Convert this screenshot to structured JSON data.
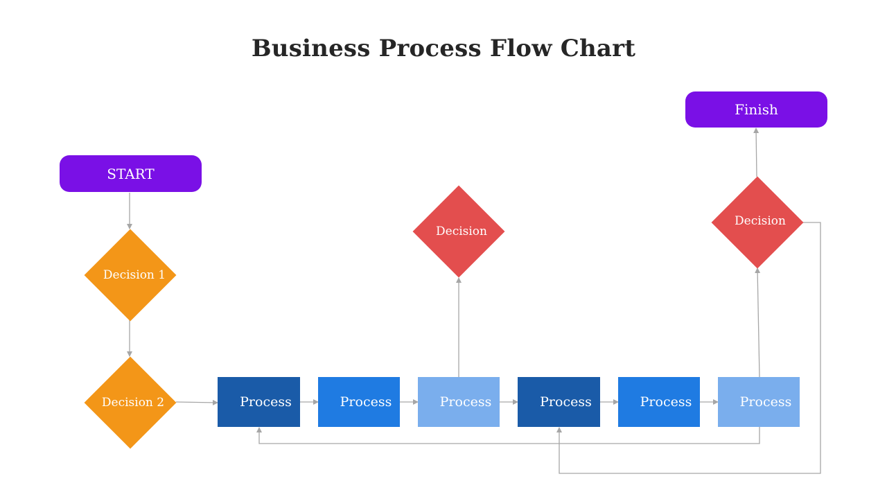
{
  "title": "Business Process Flow Chart",
  "colors": {
    "terminal": "#7a10e6",
    "decision_orange": "#f39618",
    "decision_red": "#e34e4e",
    "process_dark": "#1a5ba8",
    "process_mid": "#1f7be2",
    "process_light": "#7aaeed",
    "connector": "#a6a6a6"
  },
  "nodes": {
    "start": {
      "label": "START",
      "type": "terminal"
    },
    "finish": {
      "label": "Finish",
      "type": "terminal"
    },
    "decision1": {
      "label": "Decision 1",
      "type": "decision"
    },
    "decision2": {
      "label": "Decision 2",
      "type": "decision"
    },
    "decision_mid": {
      "label": "Decision",
      "type": "decision"
    },
    "decision_right": {
      "label": "Decision",
      "type": "decision"
    },
    "processes": [
      {
        "label": "Process",
        "shade": "dark"
      },
      {
        "label": "Process",
        "shade": "mid"
      },
      {
        "label": "Process",
        "shade": "light"
      },
      {
        "label": "Process",
        "shade": "dark"
      },
      {
        "label": "Process",
        "shade": "mid"
      },
      {
        "label": "Process",
        "shade": "light"
      }
    ]
  },
  "edges": [
    {
      "from": "start",
      "to": "decision1"
    },
    {
      "from": "decision1",
      "to": "decision2"
    },
    {
      "from": "decision2",
      "to": "process1"
    },
    {
      "from": "process1",
      "to": "process2"
    },
    {
      "from": "process2",
      "to": "process3"
    },
    {
      "from": "process3",
      "to": "decision_mid"
    },
    {
      "from": "process3",
      "to": "process4"
    },
    {
      "from": "process4",
      "to": "process5"
    },
    {
      "from": "process5",
      "to": "process6"
    },
    {
      "from": "process6",
      "to": "decision_right"
    },
    {
      "from": "process6",
      "to": "process1"
    },
    {
      "from": "decision_right",
      "to": "process4"
    },
    {
      "from": "decision_right",
      "to": "finish"
    }
  ]
}
